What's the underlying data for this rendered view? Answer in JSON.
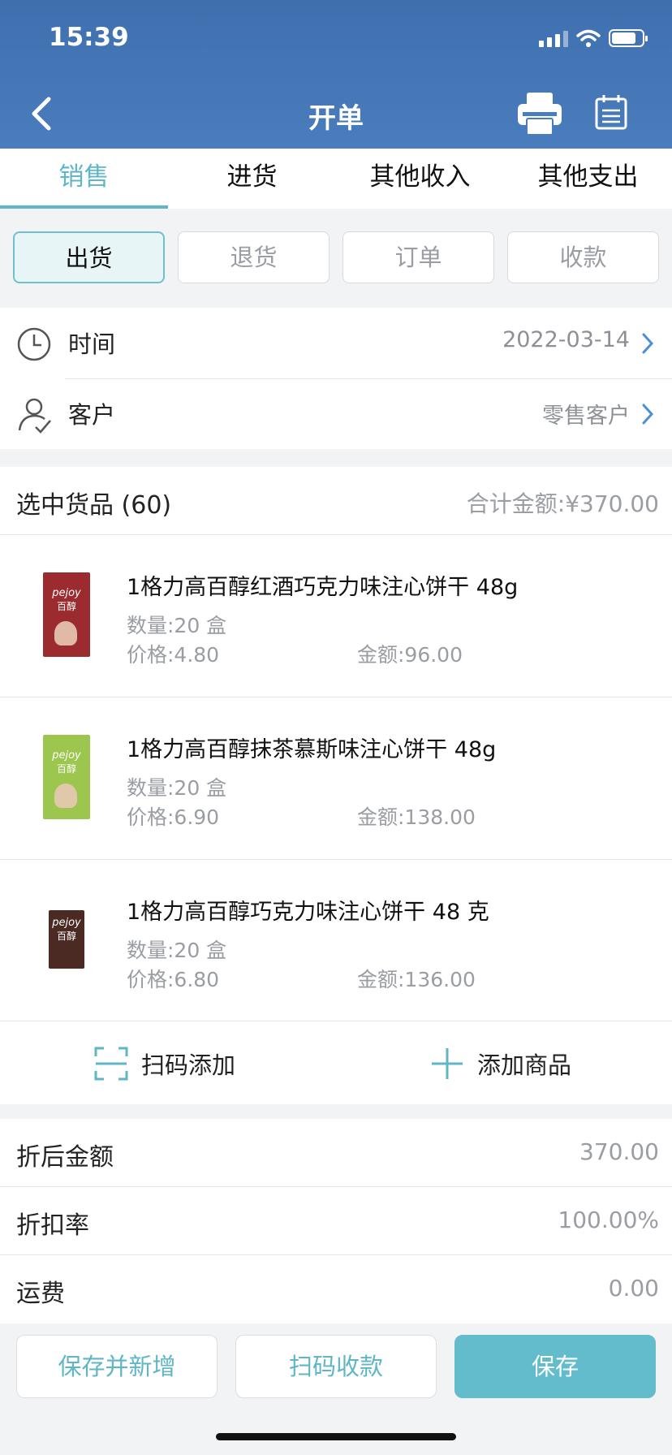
{
  "status_bar": {
    "time": "15:39",
    "battery_level": 0.8
  },
  "header": {
    "title": "开单",
    "back_icon": "chevron-left-icon",
    "print_icon": "printer-icon",
    "calendar_icon": "clipboard-icon"
  },
  "tabs": [
    {
      "label": "销售",
      "active": true
    },
    {
      "label": "进货",
      "active": false
    },
    {
      "label": "其他收入",
      "active": false
    },
    {
      "label": "其他支出",
      "active": false
    }
  ],
  "subtabs": [
    {
      "label": "出货",
      "active": true
    },
    {
      "label": "退货",
      "active": false
    },
    {
      "label": "订单",
      "active": false
    },
    {
      "label": "收款",
      "active": false
    }
  ],
  "info": {
    "time": {
      "label": "时间",
      "value": "2022-03-14",
      "icon": "clock-icon"
    },
    "customer": {
      "label": "客户",
      "value": "零售客户",
      "icon": "user-check-icon"
    }
  },
  "goods": {
    "title": "选中货品 (60)",
    "total": "合计金额:¥370.00",
    "items": [
      {
        "name": "1格力高百醇红酒巧克力味注心饼干 48g",
        "qty": "数量:20 盒",
        "price": "价格:4.80",
        "amount": "金额:96.00",
        "color": "#9b2b2e",
        "brand": "pejoy",
        "sub": "百醇"
      },
      {
        "name": "1格力高百醇抹茶慕斯味注心饼干 48g",
        "qty": "数量:20 盒",
        "price": "价格:6.90",
        "amount": "金额:138.00",
        "color": "#9cc64e",
        "brand": "pejoy",
        "sub": "百醇"
      },
      {
        "name": "1格力高百醇巧克力味注心饼干 48 克",
        "qty": "数量:20 盒",
        "price": "价格:6.80",
        "amount": "金额:136.00",
        "color": "#4a2a22",
        "brand": "pejoy",
        "sub": "百醇"
      }
    ],
    "scan_add": "扫码添加",
    "add_product": "添加商品"
  },
  "totals": [
    {
      "label": "折后金额",
      "value": "370.00"
    },
    {
      "label": "折扣率",
      "value": "100.00%"
    },
    {
      "label": "运费",
      "value": "0.00"
    }
  ],
  "footer": {
    "save_and_new": "保存并新增",
    "scan_pay": "扫码收款",
    "save": "保存"
  },
  "colors": {
    "header": "#4a7dbd",
    "accent": "#5fb6c6"
  }
}
